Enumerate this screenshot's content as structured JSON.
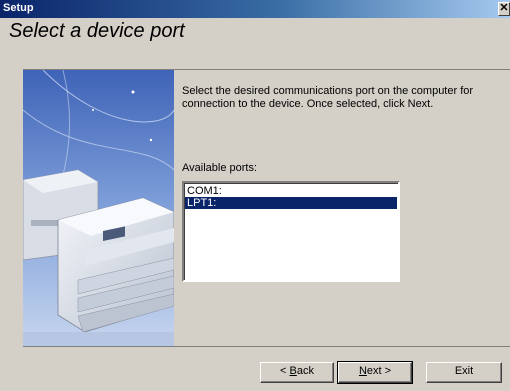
{
  "window": {
    "title": "Setup",
    "close_glyph": "✕"
  },
  "heading": "Select a device port",
  "description": "Select the desired communications port on the computer for connection to the device. Once selected, click Next.",
  "ports": {
    "label": "Available ports:",
    "items": [
      {
        "label": "COM1:",
        "selected": false
      },
      {
        "label": "LPT1:",
        "selected": true
      }
    ]
  },
  "buttons": {
    "back": {
      "prefix": "< ",
      "accel": "B",
      "rest": "ack"
    },
    "next": {
      "accel": "N",
      "rest": "ext >"
    },
    "exit": "Exit"
  },
  "colors": {
    "titlebar_start": "#0a246a",
    "titlebar_end": "#a6caf0",
    "selection": "#0a246a",
    "face": "#d4d0c8"
  }
}
